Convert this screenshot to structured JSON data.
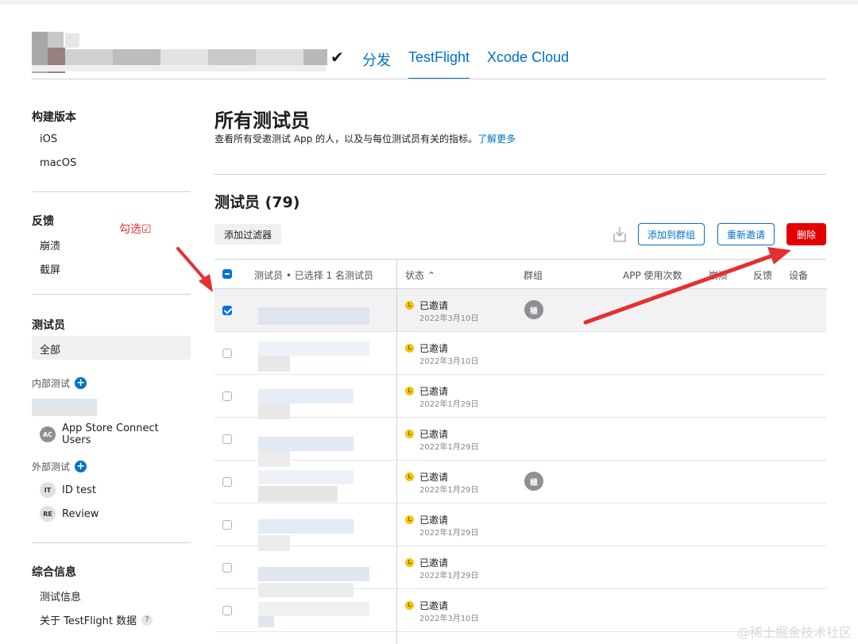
{
  "header": {
    "nav_tabs": [
      {
        "label": "分发",
        "active": false
      },
      {
        "label": "TestFlight",
        "active": true
      },
      {
        "label": "Xcode Cloud",
        "active": false
      }
    ]
  },
  "sidebar": {
    "builds": {
      "title": "构建版本",
      "items": [
        "iOS",
        "macOS"
      ]
    },
    "feedback": {
      "title": "反馈",
      "items": [
        "崩溃",
        "截屏"
      ]
    },
    "testers": {
      "title": "测试员",
      "all": "全部",
      "internal": {
        "label": "内部测试",
        "groups": [
          {
            "badge": "AC",
            "name": "App Store Connect Users"
          }
        ]
      },
      "external": {
        "label": "外部测试",
        "groups": [
          {
            "badge": "IT",
            "name": "ID test"
          },
          {
            "badge": "RE",
            "name": "Review"
          }
        ]
      }
    },
    "info": {
      "title": "综合信息",
      "items": [
        "测试信息",
        "关于 TestFlight 数据"
      ],
      "help": "?"
    }
  },
  "main": {
    "title": "所有测试员",
    "description": "查看所有受邀测试 App 的人，以及与每位测试员有关的指标。",
    "learn_more": "了解更多",
    "section_title": "测试员 (79)",
    "filter_label": "添加过滤器",
    "add_to_group_label": "添加到群组",
    "reinvite_label": "重新邀请",
    "delete_label": "删除"
  },
  "table": {
    "headers": {
      "tester": "测试员 • 已选择 1 名测试员",
      "status": "状态 ⌃",
      "group": "群组",
      "app_usage": "APP 使用次数",
      "crashes": "崩溃",
      "feedback": "反馈",
      "devices": "设备"
    },
    "rows": [
      {
        "checked": true,
        "status": "已邀请",
        "date": "2022年3月10日",
        "group": "極"
      },
      {
        "checked": false,
        "status": "已邀请",
        "date": "2022年3月10日",
        "group": ""
      },
      {
        "checked": false,
        "status": "已邀请",
        "date": "2022年1月29日",
        "group": ""
      },
      {
        "checked": false,
        "status": "已邀请",
        "date": "2022年1月29日",
        "group": ""
      },
      {
        "checked": false,
        "status": "已邀请",
        "date": "2022年1月29日",
        "group": "極"
      },
      {
        "checked": false,
        "status": "已邀请",
        "date": "2022年1月29日",
        "group": ""
      },
      {
        "checked": false,
        "status": "已邀请",
        "date": "2022年1月29日",
        "group": ""
      },
      {
        "checked": false,
        "status": "已邀请",
        "date": "2022年3月10日",
        "group": ""
      }
    ]
  },
  "annotation": {
    "text": "勾选☑"
  },
  "watermark": "@稀土掘金技术社区",
  "colors": {
    "accent": "#0070c9",
    "danger": "#e30000",
    "arrow": "#e53030",
    "status": "#f5c400"
  }
}
